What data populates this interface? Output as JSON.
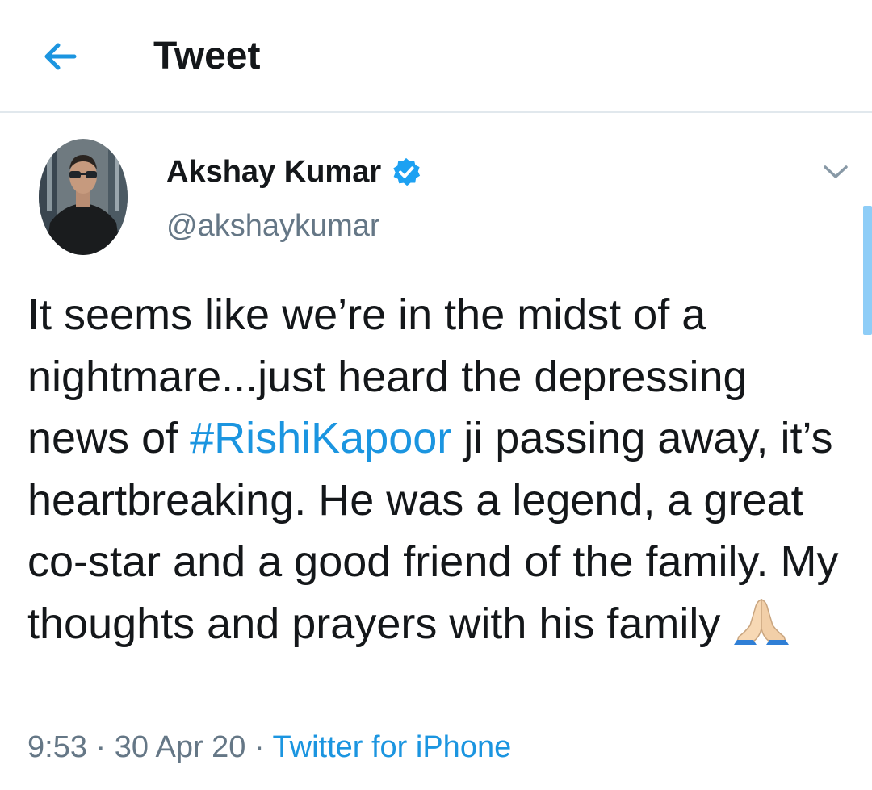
{
  "header": {
    "title": "Tweet",
    "back_icon": "arrow-left-icon"
  },
  "author": {
    "name": "Akshay Kumar",
    "handle": "@akshaykumar",
    "verified_icon": "verified-badge-icon"
  },
  "tweet": {
    "text_before_hashtag": "It seems like we’re in the midst of a nightmare...just heard the depressing news of ",
    "hashtag": "#RishiKapoor",
    "text_after_hashtag": " ji passing away, it’s heartbreaking. He was a legend, a great co-star and a good friend of the family. My thoughts and prayers with his family ",
    "emoji": "folded-hands-emoji"
  },
  "meta": {
    "time": "9:53",
    "separator": " · ",
    "date": "30 Apr 20",
    "source": "Twitter for iPhone"
  },
  "menu": {
    "icon": "chevron-down-icon"
  },
  "colors": {
    "accent": "#1b95e0",
    "secondary_text": "#657786",
    "primary_text": "#14171a",
    "divider": "#e1e8ed",
    "scrollbar": "#8ecdf7"
  }
}
